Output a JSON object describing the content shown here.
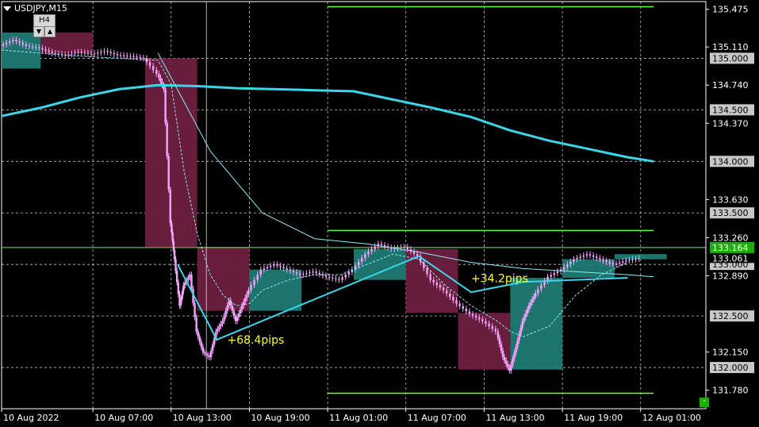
{
  "header": {
    "symbol_label": "USDJPY,M15",
    "timeframe_badge": "H4",
    "tf_down": "▼",
    "tf_up": "▲",
    "mini_button": "-"
  },
  "colors": {
    "bg": "#000000",
    "grid": "#ffffff",
    "axis": "#ffffff",
    "bull_body": "#f4a6ff",
    "bear_body": "#f4a6ff",
    "h4_bull": "#1e7a73",
    "h4_bear": "#6e1f40",
    "ma_slow": "#3ad6ea",
    "ma_fast": "#8fe9f5",
    "green_lines": "#66ff33",
    "annotation_text": "#ffff33",
    "axis_bg_box": "#c8c8c8",
    "current_price_bg": "#19b000"
  },
  "chart_data": {
    "type": "candlestick",
    "title": "USDJPY,M15",
    "ylim": [
      131.6,
      135.55
    ],
    "y_tick_labels": [
      "135.475",
      "135.110",
      "134.740",
      "134.370",
      "133.630",
      "133.260",
      "132.890",
      "132.150",
      "131.780"
    ],
    "y_tick_values": [
      135.475,
      135.11,
      134.74,
      134.37,
      133.63,
      133.26,
      132.89,
      132.15,
      131.78
    ],
    "x_labels": [
      "10 Aug 2022",
      "10 Aug 07:00",
      "10 Aug 13:00",
      "10 Aug 19:00",
      "11 Aug 01:00",
      "11 Aug 07:00",
      "11 Aug 13:00",
      "11 Aug 19:00",
      "12 Aug 01:00"
    ],
    "x_label_hours": [
      0,
      7,
      13,
      19,
      25,
      31,
      37,
      43,
      49
    ],
    "x_range_hours": [
      0,
      54
    ],
    "horizontal_levels": [
      {
        "price": 135.0,
        "label": "135.000"
      },
      {
        "price": 134.5,
        "label": "134.500"
      },
      {
        "price": 134.0,
        "label": "134.000"
      },
      {
        "price": 133.5,
        "label": "133.500"
      },
      {
        "price": 133.0,
        "label": "133.000"
      },
      {
        "price": 132.5,
        "label": "132.500"
      },
      {
        "price": 132.0,
        "label": "132.000"
      }
    ],
    "current_price": {
      "price": 133.164,
      "label": "133.164"
    },
    "bid_price": {
      "price": 133.061,
      "label": "133.061"
    },
    "range_lines": [
      {
        "price": 135.5,
        "start_hour": 25,
        "end_hour": 50
      },
      {
        "price": 133.33,
        "start_hour": 25,
        "end_hour": 50
      },
      {
        "price": 131.75,
        "start_hour": 25,
        "end_hour": 50
      }
    ],
    "h4_candles": [
      {
        "start_hour": 0,
        "end_hour": 3,
        "open": 134.9,
        "close": 135.25,
        "high": 135.3,
        "low": 134.88
      },
      {
        "start_hour": 3,
        "end_hour": 7,
        "open": 135.25,
        "close": 135.05,
        "high": 135.3,
        "low": 134.95
      },
      {
        "start_hour": 11,
        "end_hour": 15,
        "open": 135.0,
        "close": 133.17,
        "high": 135.05,
        "low": 132.1
      },
      {
        "start_hour": 15,
        "end_hour": 19,
        "open": 133.17,
        "close": 132.55,
        "high": 133.2,
        "low": 132.35
      },
      {
        "start_hour": 19,
        "end_hour": 23,
        "open": 132.55,
        "close": 132.95,
        "high": 133.1,
        "low": 132.3
      },
      {
        "start_hour": 27,
        "end_hour": 31,
        "open": 132.85,
        "close": 133.15,
        "high": 133.3,
        "low": 132.75
      },
      {
        "start_hour": 31,
        "end_hour": 35,
        "open": 133.15,
        "close": 132.53,
        "high": 133.2,
        "low": 132.3
      },
      {
        "start_hour": 35,
        "end_hour": 39,
        "open": 132.53,
        "close": 131.98,
        "high": 132.6,
        "low": 131.8
      },
      {
        "start_hour": 39,
        "end_hour": 43,
        "open": 131.98,
        "close": 132.87,
        "high": 132.95,
        "low": 131.9
      },
      {
        "start_hour": 43,
        "end_hour": 47,
        "open": 132.87,
        "close": 133.05,
        "high": 133.18,
        "low": 132.8
      },
      {
        "start_hour": 47,
        "end_hour": 51,
        "open": 133.05,
        "close": 133.1,
        "high": 133.15,
        "low": 133.0
      }
    ],
    "m15_close_path": [
      [
        0,
        135.12
      ],
      [
        1,
        135.18
      ],
      [
        2,
        135.12
      ],
      [
        3,
        135.1
      ],
      [
        4,
        135.05
      ],
      [
        5,
        135.03
      ],
      [
        6,
        135.06
      ],
      [
        7,
        135.04
      ],
      [
        8,
        135.07
      ],
      [
        9,
        135.03
      ],
      [
        10,
        135.02
      ],
      [
        11,
        135.0
      ],
      [
        12,
        134.85
      ],
      [
        12.5,
        134.7
      ],
      [
        13,
        133.4
      ],
      [
        13.3,
        133.05
      ],
      [
        13.7,
        132.6
      ],
      [
        14,
        132.8
      ],
      [
        14.5,
        132.9
      ],
      [
        15,
        132.35
      ],
      [
        15.5,
        132.15
      ],
      [
        16,
        132.1
      ],
      [
        16.5,
        132.35
      ],
      [
        17,
        132.45
      ],
      [
        17.5,
        132.65
      ],
      [
        18,
        132.45
      ],
      [
        18.5,
        132.6
      ],
      [
        19,
        132.75
      ],
      [
        20,
        132.95
      ],
      [
        21,
        133.0
      ],
      [
        22,
        132.95
      ],
      [
        23,
        132.9
      ],
      [
        24,
        132.93
      ],
      [
        25,
        132.88
      ],
      [
        26,
        132.85
      ],
      [
        27,
        132.95
      ],
      [
        28,
        133.1
      ],
      [
        29,
        133.2
      ],
      [
        30,
        133.15
      ],
      [
        31,
        133.17
      ],
      [
        32,
        133.08
      ],
      [
        33,
        132.85
      ],
      [
        34,
        132.75
      ],
      [
        35,
        132.62
      ],
      [
        36,
        132.52
      ],
      [
        37,
        132.45
      ],
      [
        38,
        132.35
      ],
      [
        38.5,
        132.1
      ],
      [
        39,
        131.97
      ],
      [
        39.5,
        132.2
      ],
      [
        40,
        132.45
      ],
      [
        40.5,
        132.6
      ],
      [
        41,
        132.72
      ],
      [
        42,
        132.88
      ],
      [
        43,
        132.95
      ],
      [
        44,
        133.05
      ],
      [
        45,
        133.1
      ],
      [
        46,
        133.05
      ],
      [
        47,
        133.0
      ],
      [
        48,
        133.04
      ],
      [
        49,
        133.06
      ]
    ],
    "ma_slow": [
      [
        0,
        134.44
      ],
      [
        3,
        134.52
      ],
      [
        6,
        134.62
      ],
      [
        9,
        134.7
      ],
      [
        12,
        134.74
      ],
      [
        15,
        134.73
      ],
      [
        18,
        134.71
      ],
      [
        21,
        134.7
      ],
      [
        24,
        134.69
      ],
      [
        27,
        134.68
      ],
      [
        30,
        134.6
      ],
      [
        33,
        134.52
      ],
      [
        36,
        134.43
      ],
      [
        39,
        134.3
      ],
      [
        42,
        134.2
      ],
      [
        45,
        134.12
      ],
      [
        48,
        134.04
      ],
      [
        50,
        134.0
      ]
    ],
    "ma_fast_dashed": [
      [
        0,
        135.08
      ],
      [
        6,
        135.02
      ],
      [
        12,
        134.98
      ],
      [
        13,
        134.75
      ],
      [
        14,
        133.9
      ],
      [
        15,
        133.3
      ],
      [
        16,
        132.9
      ],
      [
        17,
        132.7
      ],
      [
        18,
        132.6
      ],
      [
        19,
        132.62
      ],
      [
        20,
        132.75
      ],
      [
        22,
        132.85
      ],
      [
        24,
        132.9
      ],
      [
        26,
        132.9
      ],
      [
        28,
        133.0
      ],
      [
        30,
        133.1
      ],
      [
        32,
        133.05
      ],
      [
        34,
        132.8
      ],
      [
        36,
        132.6
      ],
      [
        38,
        132.45
      ],
      [
        39,
        132.35
      ],
      [
        40,
        132.3
      ],
      [
        42,
        132.4
      ],
      [
        44,
        132.7
      ],
      [
        46,
        132.9
      ],
      [
        48,
        133.02
      ]
    ],
    "ma_thin": [
      [
        12,
        135.05
      ],
      [
        16,
        134.1
      ],
      [
        20,
        133.5
      ],
      [
        24,
        133.25
      ],
      [
        28,
        133.2
      ],
      [
        32,
        133.12
      ],
      [
        36,
        133.02
      ],
      [
        40,
        132.96
      ],
      [
        44,
        132.93
      ],
      [
        48,
        132.9
      ],
      [
        50,
        132.88
      ]
    ],
    "zigzag": [
      [
        13.5,
        133.0
      ],
      [
        16.5,
        132.27
      ],
      [
        32,
        133.08
      ],
      [
        36,
        132.73
      ],
      [
        40,
        132.83
      ],
      [
        48,
        132.87
      ]
    ],
    "annotations": [
      {
        "text": "+68.4pips",
        "hour": 17.3,
        "price": 132.23
      },
      {
        "text": "+34.2pips",
        "hour": 36.0,
        "price": 132.83
      }
    ]
  }
}
